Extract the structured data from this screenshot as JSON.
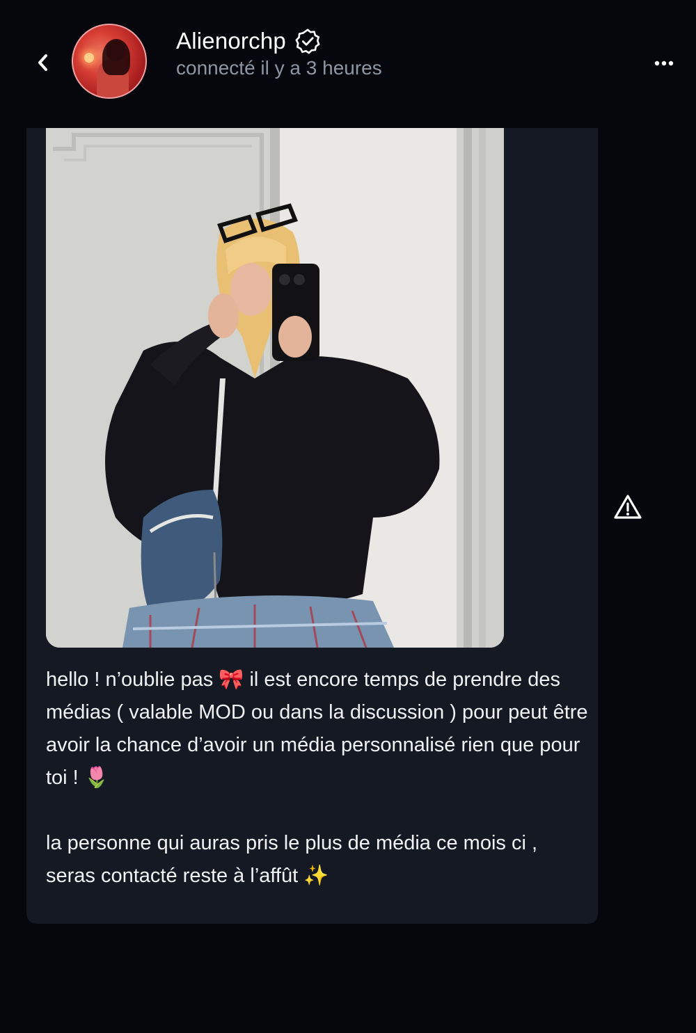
{
  "header": {
    "username": "Alienorchp",
    "status": "connecté il y a 3 heures",
    "verified": true
  },
  "icons": {
    "back": "chevron-left-icon",
    "verified": "verified-badge-icon",
    "more": "more-horizontal-icon",
    "report": "warning-triangle-icon"
  },
  "message": {
    "text": "hello ! n’oublie pas 🎀 il est encore temps de prendre des médias ( valable MOD ou dans la discussion ) pour peut être avoir la chance d’avoir un média personnalisé rien que pour toi ! 🌷\n\nla personne qui auras pris le plus de média ce mois ci , seras contacté reste à l’affût ✨"
  },
  "colors": {
    "background": "#05070c",
    "bubble": "#141923",
    "status_text": "#8f96a3",
    "text": "#f1f2f4"
  }
}
